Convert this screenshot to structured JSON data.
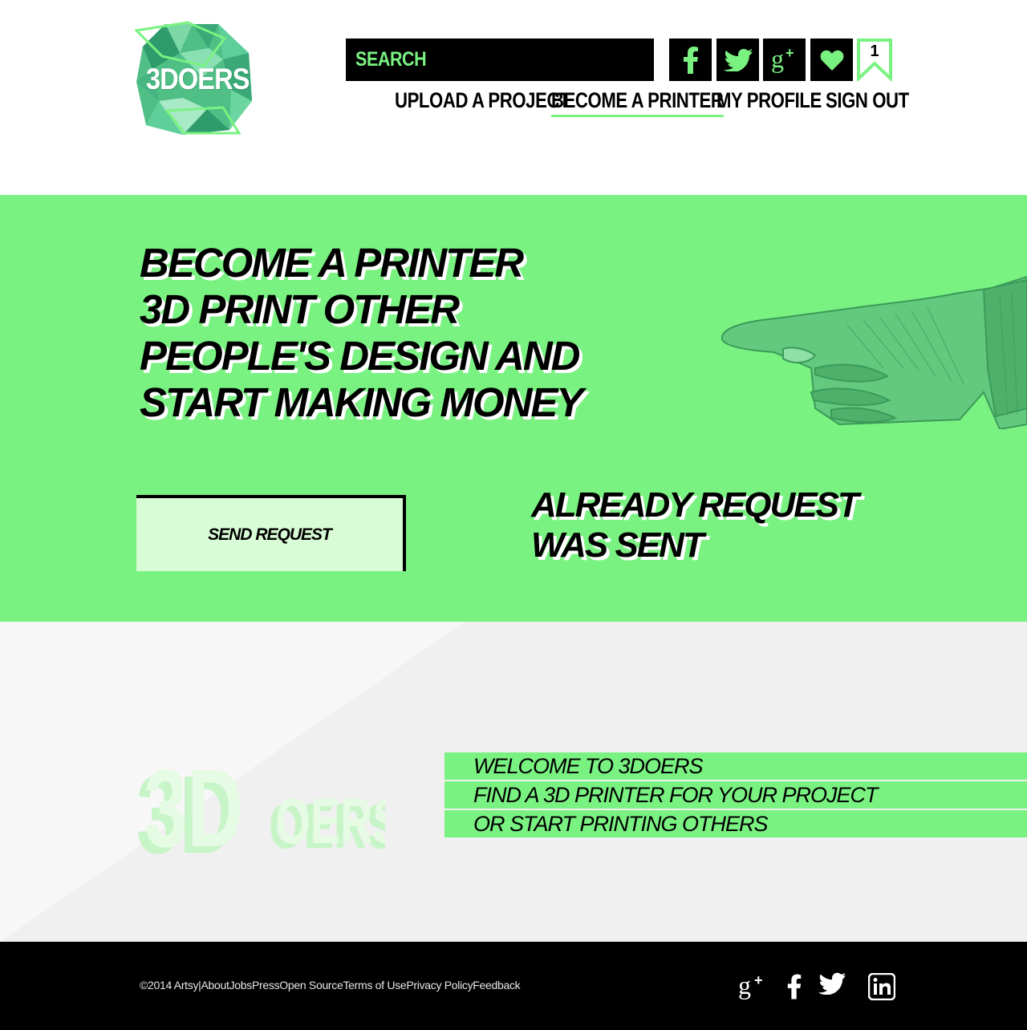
{
  "brand": {
    "logo_text": "3DOERS",
    "accent": "#7af282",
    "dark": "#000000"
  },
  "header": {
    "search_placeholder": "SEARCH",
    "social": [
      "facebook-icon",
      "twitter-icon",
      "google-plus-icon",
      "heart-icon"
    ],
    "bookmark_count": "1",
    "nav": [
      {
        "label": "UPLOAD A PROJECT",
        "active": false
      },
      {
        "label": "BECOME A PRINTER",
        "active": true
      },
      {
        "label": "MY PROFILE",
        "active": false
      },
      {
        "label": "SIGN OUT",
        "active": false
      }
    ]
  },
  "hero": {
    "title_lines": [
      "BECOME A PRINTER",
      "3D PRINT OTHER",
      "PEOPLE'S DESIGN AND",
      "START MAKING MONEY"
    ],
    "send_button": "SEND REQUEST",
    "status_lines": [
      "ALREADY REQUEST",
      "WAS SENT"
    ]
  },
  "welcome": {
    "lines": [
      "WELCOME TO 3DOERS",
      "FIND A 3D PRINTER FOR YOUR  PROJECT",
      "OR START PRINTING  OTHERS"
    ]
  },
  "footer": {
    "copyright": "©2014 Artsy",
    "separator": "|",
    "links": [
      "About",
      "Jobs",
      "Press",
      "Open Source",
      "Terms of Use",
      "Privacy Policy",
      "Feedback"
    ],
    "social": [
      "google-plus-icon",
      "facebook-icon",
      "twitter-icon",
      "linkedin-icon"
    ]
  }
}
